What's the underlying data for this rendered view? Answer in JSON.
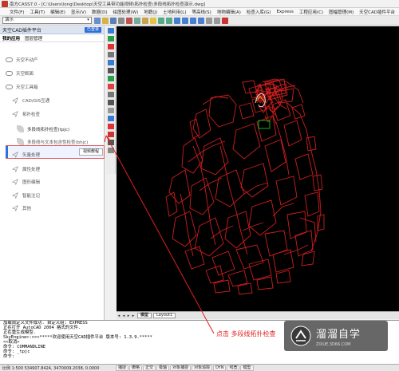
{
  "window": {
    "title": "南方CASS7.0 - [C:\\Users\\long\\Desktop\\天空工具带功能视频\\拓扑检查\\多段线拓扑检查演示.dwg]"
  },
  "menu": [
    "文件(F)",
    "工具(T)",
    "编辑(E)",
    "显示(V)",
    "数据(D)",
    "绘图处理(W)",
    "地籍(J)",
    "土地利用(L)",
    "等高线(S)",
    "地物编辑(A)",
    "检查入库(G)",
    "Express",
    "工程应用(C)",
    "图幅管理(M)",
    "天空CAD插件平台"
  ],
  "toolbar": {
    "layer_combo": "演示",
    "combo_arrow": "▾"
  },
  "panel": {
    "title": "天空CAD插件平台",
    "login_label": "已登录",
    "tabs": [
      "我的应用",
      "图层管理"
    ],
    "categories": [
      {
        "label": "天空不动产",
        "icon": "cloud-icon"
      },
      {
        "label": "天空断面",
        "icon": "cloud-icon"
      },
      {
        "label": "天空工具箱",
        "icon": "cloud-icon"
      }
    ],
    "items": [
      {
        "label": "CAD/GIS互通"
      },
      {
        "label": "拓扑检查"
      },
      {
        "label": "多段线拓扑检查(tpjc)"
      },
      {
        "label": "多段线与文本包含性检查(bhjc)"
      },
      {
        "label": "矢量处理"
      },
      {
        "label": "属性处理"
      },
      {
        "label": "图形编辑"
      },
      {
        "label": "智能注记"
      },
      {
        "label": "其他"
      }
    ],
    "video_button": "视频教程"
  },
  "layout_tabs": {
    "nav": [
      "◂",
      "◂",
      "▸",
      "▸"
    ],
    "tabs": [
      "模型",
      "Layout1"
    ]
  },
  "command_lines": [
    "加载自定义文件成功. 自定义组: EXPRESS",
    "正在打开 AutoCAD 2004 格式的文件.",
    "正在重生成模型.",
    "SkyEngine>:>>>*****欢迎使用天空CAD插件平台 版本号: 1.3.9.*****",
    "<<取消>",
    "命令: COMMANDLINE",
    "命令: _tpjc",
    "命令:"
  ],
  "status": {
    "coords": "比例 1:500  534907.8424, 3470009.2038, 0.0000",
    "buttons": [
      "捕捉",
      "栅格",
      "正交",
      "极轴",
      "对象捕捉",
      "对象追踪",
      "DYN",
      "线宽",
      "模型"
    ]
  },
  "annotation": "点击  多段线拓扑检查",
  "watermark": {
    "big": "溜溜自学",
    "small": "ZIXUE.3D66.COM"
  },
  "colors": {
    "canvas": "#000000",
    "polylines": "#cc1e1e",
    "highlight_box": "#19b219",
    "annotation": "#e02020",
    "accent": "#2f6fd6"
  }
}
